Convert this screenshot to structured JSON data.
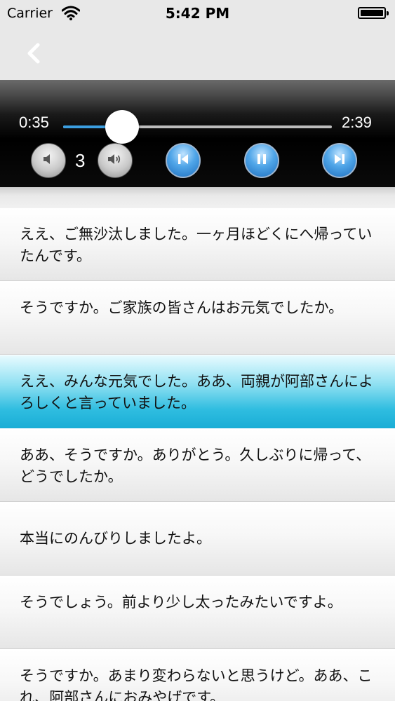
{
  "status_bar": {
    "carrier": "Carrier",
    "time": "5:42 PM",
    "wifi_icon": "wifi-icon",
    "battery_icon": "battery-icon"
  },
  "nav_bar": {
    "back_icon": "chevron-left-icon"
  },
  "player": {
    "current_time": "0:35",
    "total_time": "2:39",
    "progress": 0.2201,
    "volume_level": "3",
    "accent_color": "#3b9ee0",
    "icons": {
      "volume_down": "volume-down-icon",
      "volume_up": "volume-up-icon",
      "previous": "skip-previous-icon",
      "pause": "pause-icon",
      "next": "skip-next-icon"
    }
  },
  "dialogue": {
    "active_index": 2,
    "items": [
      {
        "text": "ええ、ご無沙汰しました。一ヶ月ほどくにへ帰っていたんです。"
      },
      {
        "text": "そうですか。ご家族の皆さんはお元気でしたか。"
      },
      {
        "text": "ええ、みんな元気でした。ああ、両親が阿部さんによろしくと言っていました。"
      },
      {
        "text": "ああ、そうですか。ありがとう。久しぶりに帰って、どうでしたか。"
      },
      {
        "text": "本当にのんびりしましたよ。"
      },
      {
        "text": "そうでしょう。前より少し太ったみたいですよ。"
      },
      {
        "text": "そうですか。あまり変わらないと思うけど。ああ、これ、阿部さんにおみやげです。"
      }
    ]
  }
}
